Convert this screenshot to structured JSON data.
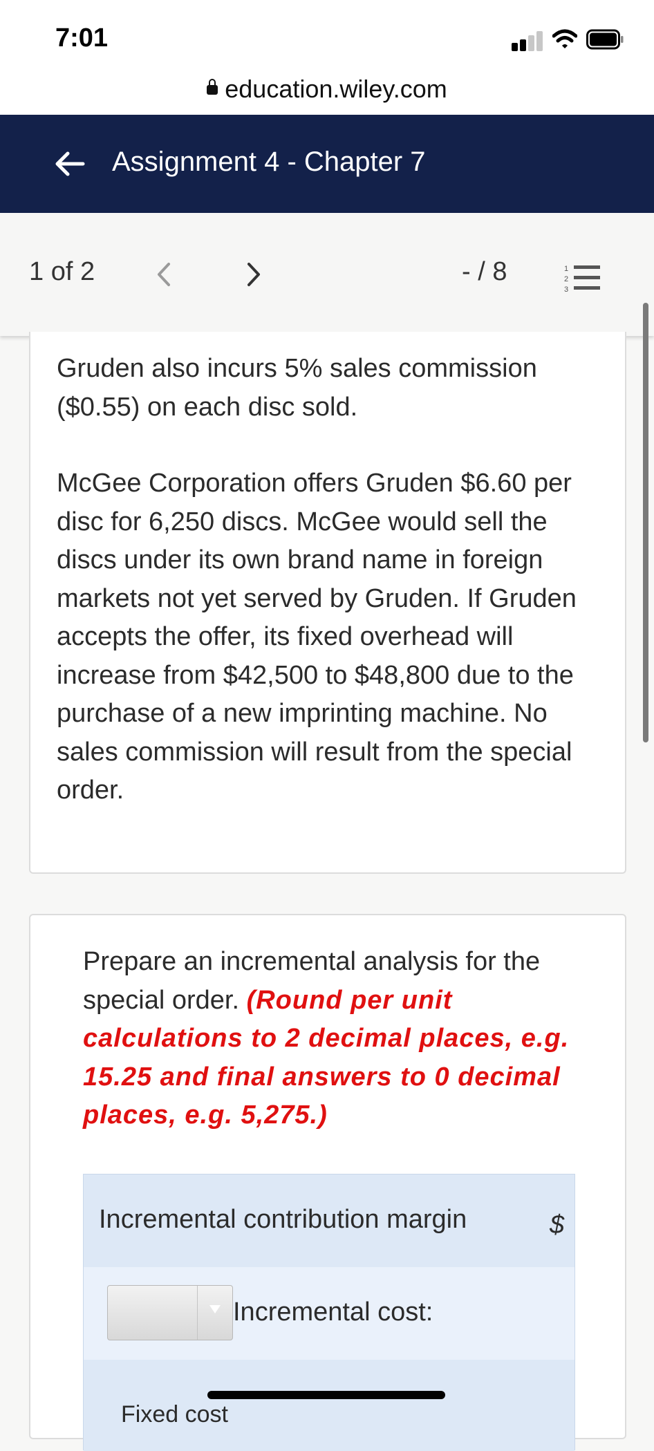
{
  "status_bar": {
    "time": "7:01",
    "icons": [
      "signal-icon",
      "wifi-icon",
      "battery-icon"
    ]
  },
  "browser": {
    "url": "education.wiley.com",
    "lock_icon": "lock-icon"
  },
  "header": {
    "back_icon": "back-arrow-icon",
    "title": "Assignment 4 - Chapter 7",
    "background_color": "#13214a"
  },
  "pager": {
    "page_count": "1 of 2",
    "prev_icon": "chevron-left-icon",
    "next_icon": "chevron-right-icon",
    "score": "- / 8",
    "list_icon": "numbered-list-icon"
  },
  "question": {
    "paragraph1": "Gruden also incurs 5% sales commission ($0.55) on each disc sold.",
    "paragraph2": "McGee Corporation offers Gruden $6.60 per disc for 6,250 discs. McGee would sell the discs under its own brand name in foreign markets not yet served by Gruden. If Gruden accepts the offer, its fixed overhead will increase from $42,500 to $48,800 due to the purchase of a new imprinting machine. No sales commission will result from the special order."
  },
  "task": {
    "instruction": "Prepare an incremental analysis for the special order.",
    "rounding_note": "(Round per unit calculations to 2 decimal places, e.g. 15.25 and final answers to 0 decimal places, e.g. 5,275.)",
    "note_color": "#e01010"
  },
  "analysis_table": {
    "row1_label": "Incremental contribution margin",
    "currency_symbol": "$",
    "row2_dropdown_value": "",
    "row2_label": "Incremental cost:",
    "row3_label": "Fixed cost"
  }
}
